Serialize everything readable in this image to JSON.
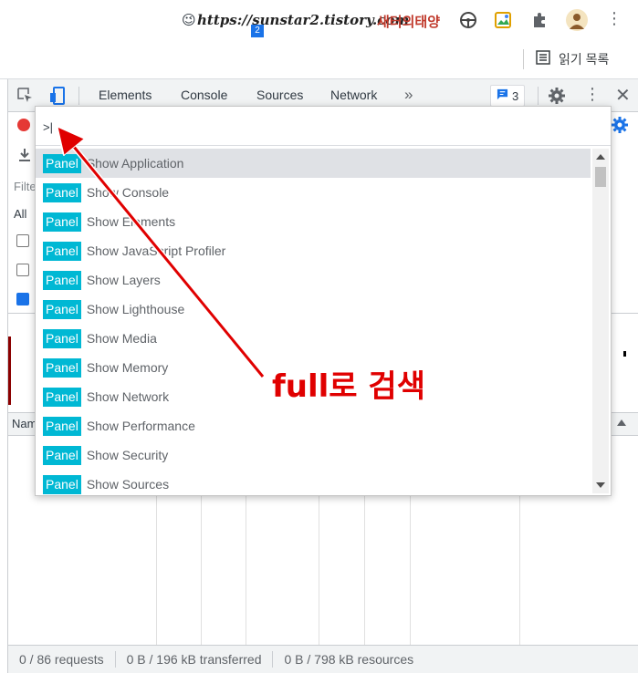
{
  "browser": {
    "url_text": "https://sunstar2.tistory.com",
    "extension_label": "새터의태양",
    "tab_badge": "2",
    "reading_list_label": "읽기 목록"
  },
  "devtools": {
    "tabs": [
      "Elements",
      "Console",
      "Sources",
      "Network"
    ],
    "more_tabs_icon": "chevron-double-right-icon",
    "issues_count": "3",
    "left_strip": {
      "filter_label": "Filte",
      "all_label": "All",
      "name_header": "Nam"
    },
    "status": {
      "requests": "0 / 86 requests",
      "transferred": "0 B / 196 kB transferred",
      "resources": "0 B / 798 kB resources"
    }
  },
  "command_menu": {
    "input_value": ">|",
    "items": [
      {
        "tag": "Panel",
        "label": "Show Application",
        "selected": true
      },
      {
        "tag": "Panel",
        "label": "Show Console"
      },
      {
        "tag": "Panel",
        "label": "Show Elements"
      },
      {
        "tag": "Panel",
        "label": "Show JavaScript Profiler"
      },
      {
        "tag": "Panel",
        "label": "Show Layers"
      },
      {
        "tag": "Panel",
        "label": "Show Lighthouse"
      },
      {
        "tag": "Panel",
        "label": "Show Media"
      },
      {
        "tag": "Panel",
        "label": "Show Memory"
      },
      {
        "tag": "Panel",
        "label": "Show Network"
      },
      {
        "tag": "Panel",
        "label": "Show Performance"
      },
      {
        "tag": "Panel",
        "label": "Show Security"
      },
      {
        "tag": "Panel",
        "label": "Show Sources"
      }
    ]
  },
  "annotation": {
    "text": "full로 검색",
    "color": "#e00000"
  },
  "colors": {
    "tag_bg": "#00b8d4",
    "record": "#e53935",
    "accent": "#1a73e8"
  }
}
